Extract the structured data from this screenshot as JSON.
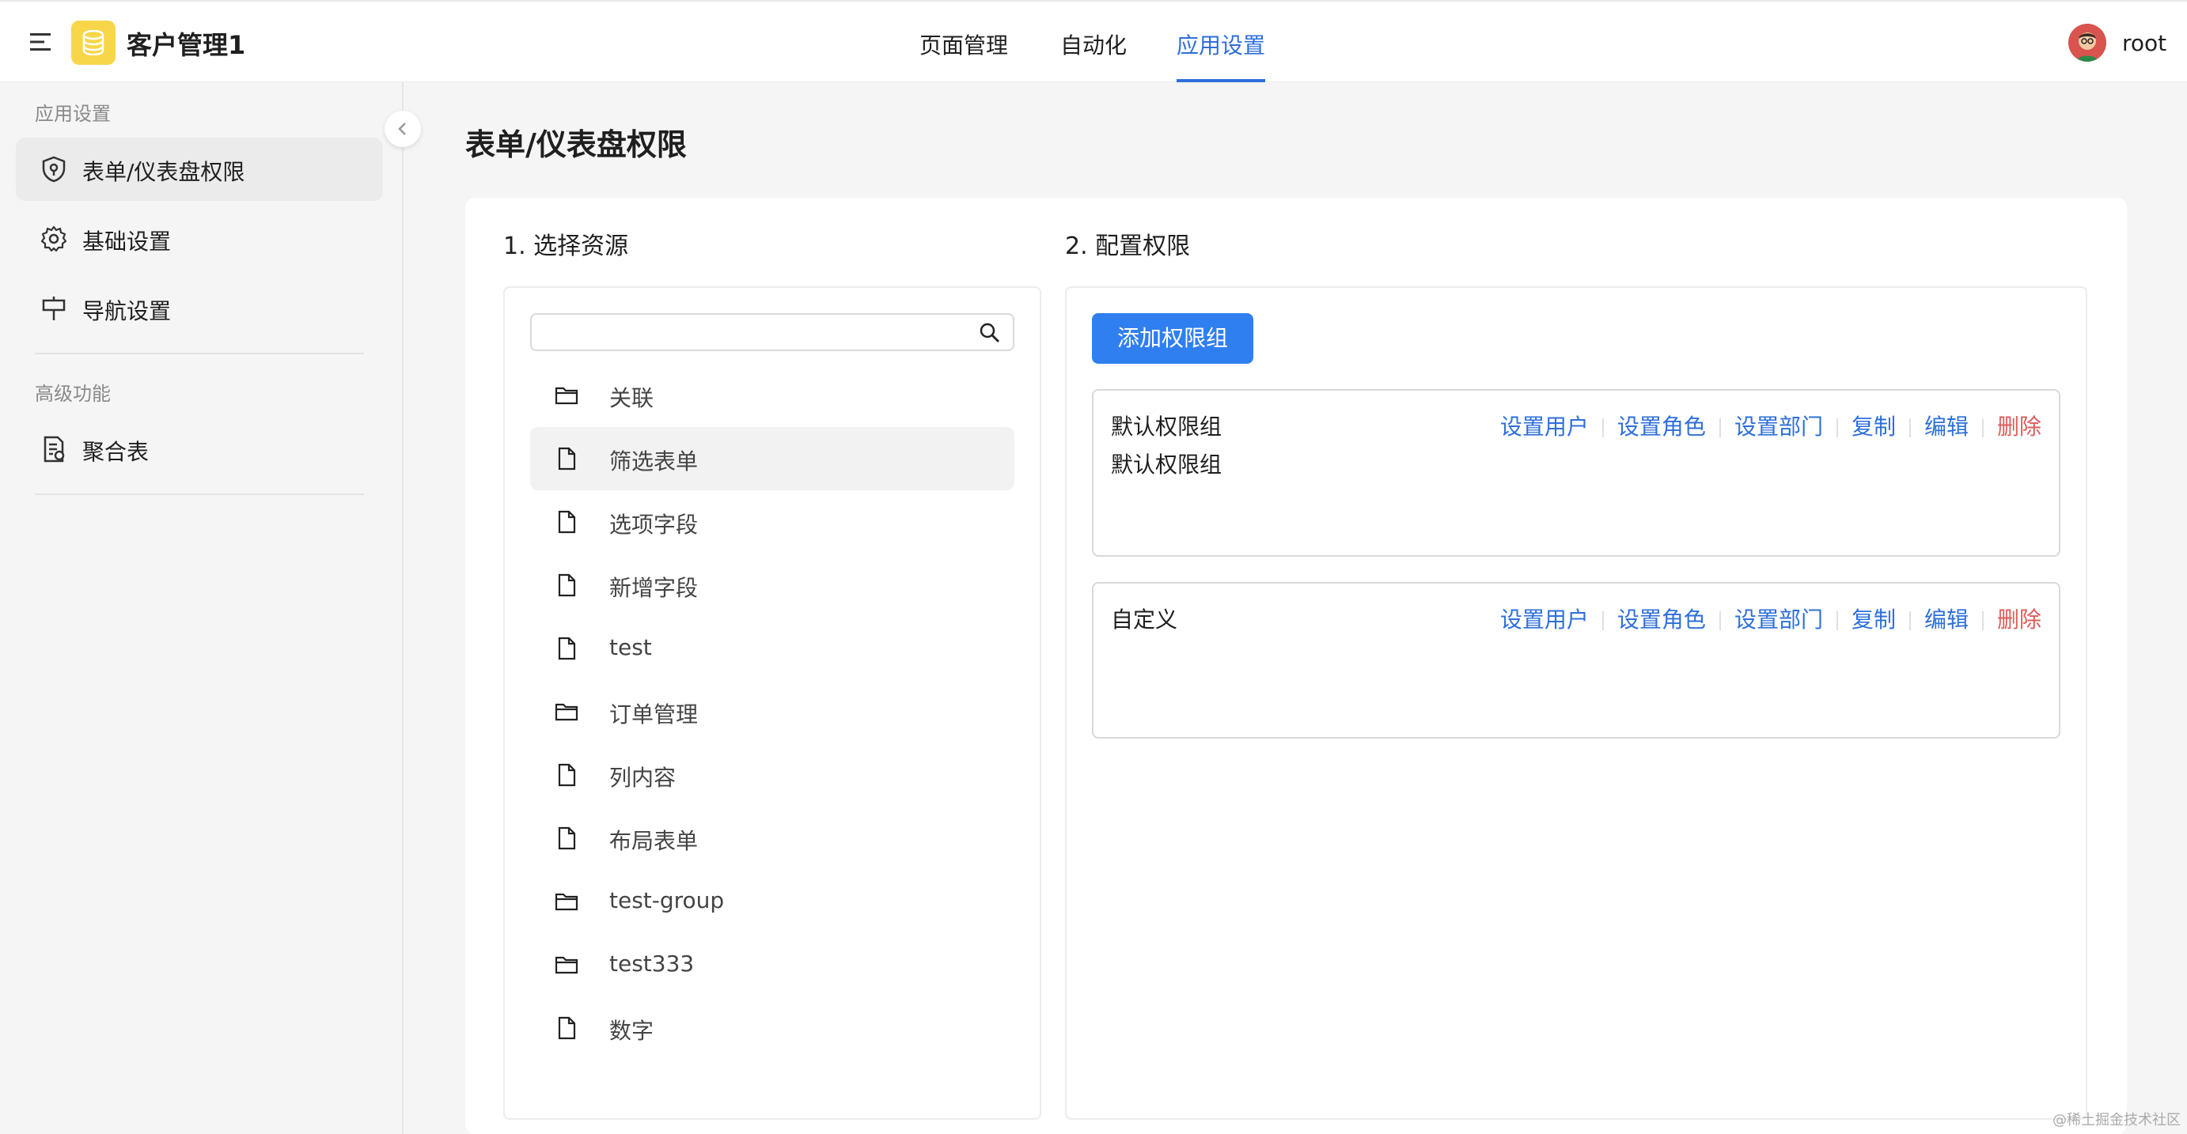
{
  "header": {
    "app_title": "客户管理1",
    "tabs": [
      {
        "label": "页面管理"
      },
      {
        "label": "自动化"
      },
      {
        "label": "应用设置"
      }
    ],
    "active_tab": "应用设置",
    "user": "root",
    "accent_color": "#2f6fd9"
  },
  "sidebar": {
    "section1": "应用设置",
    "items": [
      {
        "label": "表单/仪表盘权限",
        "icon": "shield-icon",
        "active": true
      },
      {
        "label": "基础设置",
        "icon": "gear-icon"
      },
      {
        "label": "导航设置",
        "icon": "signpost-icon"
      }
    ],
    "section2": "高级功能",
    "advanced_items": [
      {
        "label": "聚合表",
        "icon": "report-icon"
      }
    ]
  },
  "main": {
    "title": "表单/仪表盘权限",
    "step1": "1. 选择资源",
    "step2": "2. 配置权限",
    "search_placeholder": "",
    "resources": [
      {
        "label": "关联",
        "type": "folder"
      },
      {
        "label": "筛选表单",
        "type": "file",
        "selected": true
      },
      {
        "label": "选项字段",
        "type": "file"
      },
      {
        "label": "新增字段",
        "type": "file"
      },
      {
        "label": "test",
        "type": "file"
      },
      {
        "label": "订单管理",
        "type": "folder"
      },
      {
        "label": "列内容",
        "type": "file"
      },
      {
        "label": "布局表单",
        "type": "file"
      },
      {
        "label": "test-group",
        "type": "folder"
      },
      {
        "label": "test333",
        "type": "folder"
      },
      {
        "label": "数字",
        "type": "file"
      }
    ],
    "add_group_label": "添加权限组",
    "groups": [
      {
        "name": "默认权限组",
        "description": "默认权限组"
      },
      {
        "name": "自定义",
        "description": ""
      }
    ],
    "actions": {
      "set_users": "设置用户",
      "set_roles": "设置角色",
      "set_departments": "设置部门",
      "copy": "复制",
      "edit": "编辑",
      "delete": "删除"
    },
    "danger_color": "#e05b5b",
    "button_color": "#2f7ff0"
  },
  "watermark": "@稀土掘金技术社区"
}
